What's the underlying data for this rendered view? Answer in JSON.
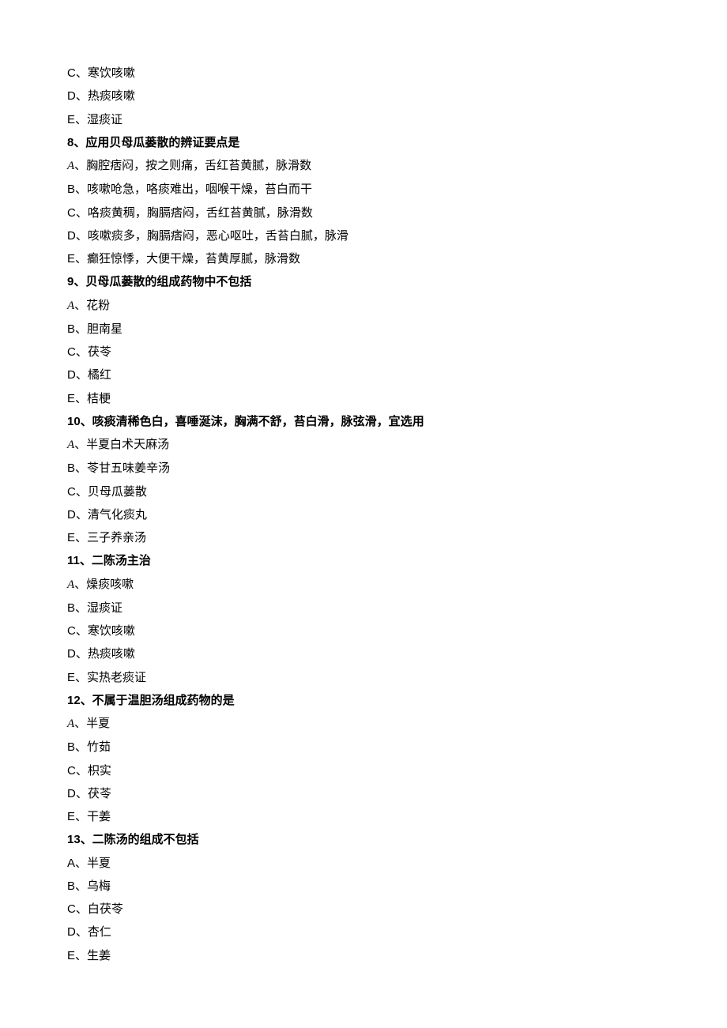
{
  "lines": [
    {
      "type": "option",
      "letter": "C",
      "letterStyle": "plain",
      "text": "、寒饮咳嗽"
    },
    {
      "type": "option",
      "letter": "D",
      "letterStyle": "plain",
      "text": "、热痰咳嗽"
    },
    {
      "type": "option",
      "letter": "E",
      "letterStyle": "plain",
      "text": "、湿痰证"
    },
    {
      "type": "question",
      "text": "8、应用贝母瓜蒌散的辨证要点是"
    },
    {
      "type": "option",
      "letter": "A",
      "letterStyle": "italic",
      "text": "、胸腔痞闷，按之则痛，舌红苔黄腻，脉滑数"
    },
    {
      "type": "option",
      "letter": "B",
      "letterStyle": "plain",
      "text": "、咳嗽呛急，咯痰难出，咽喉干燥，苔白而干"
    },
    {
      "type": "option",
      "letter": "C",
      "letterStyle": "plain",
      "text": "、咯痰黄稠，胸膈痞闷，舌红苔黄腻，脉滑数"
    },
    {
      "type": "option",
      "letter": "D",
      "letterStyle": "plain",
      "text": "、咳嗽痰多，胸膈痞闷，恶心呕吐，舌苔白腻，脉滑"
    },
    {
      "type": "option",
      "letter": "E",
      "letterStyle": "plain",
      "text": "、癫狂惊悸，大便干燥，苔黄厚腻，脉滑数"
    },
    {
      "type": "question",
      "text": "9、贝母瓜蒌散的组成药物中不包括"
    },
    {
      "type": "option",
      "letter": "A",
      "letterStyle": "italic",
      "text": "、花粉"
    },
    {
      "type": "option",
      "letter": "B",
      "letterStyle": "plain",
      "text": "、胆南星"
    },
    {
      "type": "option",
      "letter": "C",
      "letterStyle": "plain",
      "text": "、茯苓"
    },
    {
      "type": "option",
      "letter": "D",
      "letterStyle": "plain",
      "text": "、橘红"
    },
    {
      "type": "option",
      "letter": "E",
      "letterStyle": "plain",
      "text": "、桔梗"
    },
    {
      "type": "question",
      "text": "10、咳痰清稀色白，喜唾涎沫，胸满不舒，苔白滑，脉弦滑，宜选用"
    },
    {
      "type": "option",
      "letter": "A",
      "letterStyle": "italic",
      "text": "、半夏白术天麻汤"
    },
    {
      "type": "option",
      "letter": "B",
      "letterStyle": "plain",
      "text": "、苓甘五味姜辛汤"
    },
    {
      "type": "option",
      "letter": "C",
      "letterStyle": "plain",
      "text": "、贝母瓜蒌散"
    },
    {
      "type": "option",
      "letter": "D",
      "letterStyle": "plain",
      "text": "、清气化痰丸"
    },
    {
      "type": "option",
      "letter": "E",
      "letterStyle": "plain",
      "text": "、三子养亲汤"
    },
    {
      "type": "question",
      "text": "11、二陈汤主治"
    },
    {
      "type": "option",
      "letter": "A",
      "letterStyle": "italic",
      "text": "、燥痰咳嗽"
    },
    {
      "type": "option",
      "letter": "B",
      "letterStyle": "plain",
      "text": "、湿痰证"
    },
    {
      "type": "option",
      "letter": "C",
      "letterStyle": "plain",
      "text": "、寒饮咳嗽"
    },
    {
      "type": "option",
      "letter": "D",
      "letterStyle": "plain",
      "text": "、热痰咳嗽"
    },
    {
      "type": "option",
      "letter": "E",
      "letterStyle": "plain",
      "text": "、实热老痰证"
    },
    {
      "type": "question",
      "text": "12、不属于温胆汤组成药物的是"
    },
    {
      "type": "option",
      "letter": "A",
      "letterStyle": "italic",
      "text": "、半夏"
    },
    {
      "type": "option",
      "letter": "B",
      "letterStyle": "plain",
      "text": "、竹茹"
    },
    {
      "type": "option",
      "letter": "C",
      "letterStyle": "plain",
      "text": "、枳实"
    },
    {
      "type": "option",
      "letter": "D",
      "letterStyle": "plain",
      "text": "、茯苓"
    },
    {
      "type": "option",
      "letter": "E",
      "letterStyle": "plain",
      "text": "、干姜"
    },
    {
      "type": "question",
      "text": "13、二陈汤的组成不包括"
    },
    {
      "type": "option",
      "letter": "A",
      "letterStyle": "plain",
      "text": "、半夏"
    },
    {
      "type": "option",
      "letter": "B",
      "letterStyle": "plain",
      "text": "、乌梅"
    },
    {
      "type": "option",
      "letter": "C",
      "letterStyle": "plain",
      "text": "、白茯苓"
    },
    {
      "type": "option",
      "letter": "D",
      "letterStyle": "plain",
      "text": "、杏仁"
    },
    {
      "type": "option",
      "letter": "E",
      "letterStyle": "plain",
      "text": "、生姜"
    }
  ]
}
